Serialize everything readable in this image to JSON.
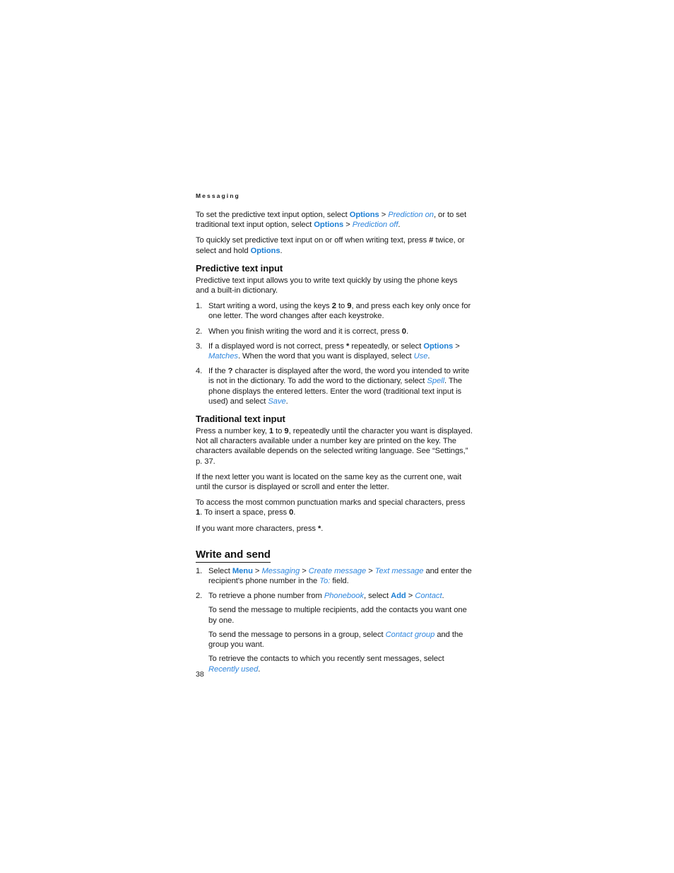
{
  "document": {
    "running_header": "Messaging",
    "page_number": "38"
  },
  "intro": {
    "para1_part1": "To set the predictive text input option, select ",
    "para1_link1": "Options",
    "para1_sep1": " > ",
    "para1_link2": "Prediction on",
    "para1_part2": ", or to set traditional text input option, select ",
    "para1_link3": "Options",
    "para1_sep2": " > ",
    "para1_link4": "Prediction off",
    "para1_part3": ".",
    "para2_part1": "To quickly set predictive text input on or off when writing text, press ",
    "para2_bold1": "#",
    "para2_part2": " twice, or select and hold ",
    "para2_link1": "Options",
    "para2_part3": "."
  },
  "predictive": {
    "heading": "Predictive text input",
    "intro": "Predictive text input allows you to write text quickly by using the phone keys and a built-in dictionary.",
    "steps": [
      {
        "num": "1.",
        "part1": "Start writing a word, using the keys ",
        "bold1": "2",
        "part2": " to ",
        "bold2": "9",
        "part3": ", and press each key only once for one letter. The word changes after each keystroke."
      },
      {
        "num": "2.",
        "part1": "When you finish writing the word and it is correct, press ",
        "bold1": "0",
        "part2": "."
      },
      {
        "num": "3.",
        "part1": "If a displayed word is not correct, press ",
        "bold1": "*",
        "part2": " repeatedly, or select ",
        "link1": "Options",
        "sep1": " > ",
        "link2": "Matches",
        "part3": ". When the word that you want is displayed, select ",
        "link3": "Use",
        "part4": "."
      },
      {
        "num": "4.",
        "part1": "If the ",
        "bold1": "?",
        "part2": " character is displayed after the word, the word you intended to write is not in the dictionary. To add the word to the dictionary, select ",
        "link1": "Spell",
        "part3": ". The phone displays the entered letters. Enter the word (traditional text input is used) and select ",
        "link2": "Save",
        "part4": "."
      }
    ]
  },
  "traditional": {
    "heading": "Traditional text input",
    "para1_part1": "Press a number key, ",
    "para1_bold1": "1",
    "para1_part2": " to ",
    "para1_bold2": "9",
    "para1_part3": ", repeatedly until the character you want is displayed. Not all characters available under a number key are printed on the key. The characters available depends on the selected writing language. See “Settings,” p. 37.",
    "para2": "If the next letter you want is located on the same key as the current one, wait until the cursor is displayed or scroll and enter the letter.",
    "para3_part1": "To access the most common punctuation marks and special characters, press ",
    "para3_bold1": "1",
    "para3_part2": ". To insert a space, press ",
    "para3_bold2": "0",
    "para3_part3": ".",
    "para4_part1": "If you want more characters, press ",
    "para4_bold1": "*",
    "para4_part2": "."
  },
  "write_and_send": {
    "heading": "Write and send",
    "steps": [
      {
        "num": "1.",
        "part1": "Select ",
        "link1": "Menu",
        "sep1": " > ",
        "link2": "Messaging",
        "sep2": " > ",
        "link3": "Create message",
        "sep3": " > ",
        "link4": "Text message",
        "part2": " and enter the recipient's phone number in the ",
        "link5": "To:",
        "part3": " field."
      },
      {
        "num": "2.",
        "part1": "To retrieve a phone number from ",
        "link1": "Phonebook",
        "part2": ", select ",
        "link2": "Add",
        "sep1": " > ",
        "link3": "Contact",
        "part3": ".",
        "sub1": "To send the message to multiple recipients, add the contacts you want one by one.",
        "sub2_part1": "To send the message to persons in a group, select ",
        "sub2_link1": "Contact group",
        "sub2_part2": " and the group you want.",
        "sub3_part1": "To retrieve the contacts to which you recently sent messages, select ",
        "sub3_link1": "Recently used",
        "sub3_part2": "."
      }
    ]
  },
  "colors": {
    "link_bold": "#1d7fd4",
    "link_italic": "#2f86dd",
    "text": "#1a1a1a"
  }
}
